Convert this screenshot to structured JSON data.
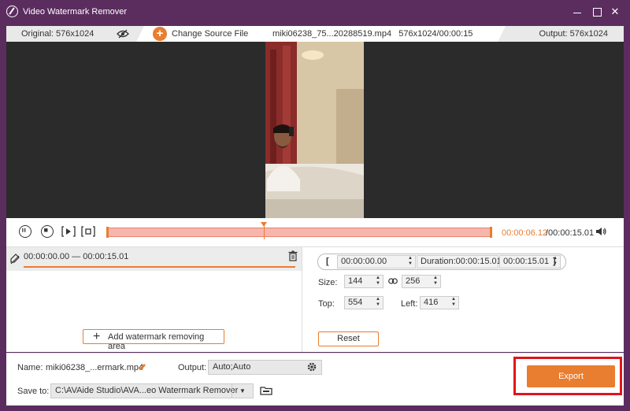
{
  "app": {
    "title": "Video Watermark Remover"
  },
  "infobar": {
    "original": "Original: 576x1024",
    "change_source": "Change Source File",
    "file_info": "miki06238_75...20288519.mp4   576x1024/00:00:15",
    "output": "Output: 576x1024"
  },
  "timeline": {
    "current": "00:00:06.12",
    "total": "/00:00:15.01",
    "progress": 0.407
  },
  "segment": {
    "range": "00:00:00.00 — 00:00:15.01"
  },
  "add_area_label": "Add watermark removing area",
  "range": {
    "start": "00:00:00.00",
    "duration": "Duration:00:00:15.01",
    "end": "00:00:15.01",
    "open": "[",
    "close": "]"
  },
  "size": {
    "label": "Size:",
    "width": "144",
    "height": "256"
  },
  "position": {
    "top_label": "Top:",
    "top": "554",
    "left_label": "Left:",
    "left": "416"
  },
  "reset_label": "Reset",
  "bottom": {
    "name_label": "Name:",
    "name_value": "miki06238_...ermark.mp4",
    "output_label": "Output:",
    "output_value": "Auto;Auto",
    "save_label": "Save to:",
    "save_value": "C:\\AVAide Studio\\AVA...eo Watermark Remover",
    "export_label": "Export"
  },
  "colors": {
    "accent": "#e97d30",
    "frame": "#5b2d5f",
    "highlight": "#e0141b"
  },
  "icons": [
    "app-logo-icon",
    "eye-slash-icon",
    "plus-circle-icon",
    "pause-icon",
    "stop-icon",
    "play-frame-icon",
    "crop-frame-icon",
    "volume-icon",
    "eraser-icon",
    "trash-icon",
    "link-icon",
    "edit-icon",
    "gear-icon",
    "dropdown-arrow-icon",
    "folder-icon"
  ]
}
